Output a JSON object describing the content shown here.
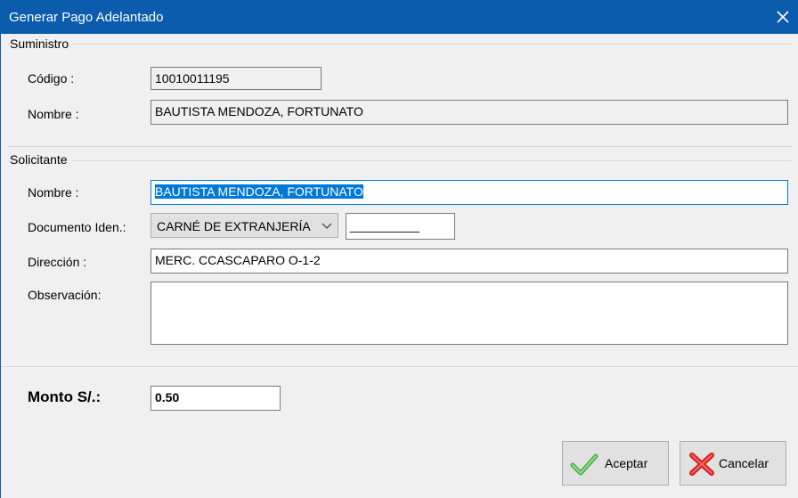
{
  "window": {
    "title": "Generar Pago Adelantado"
  },
  "suministro": {
    "group_title": "Suministro",
    "codigo_label": "Código :",
    "codigo_value": "10010011195",
    "nombre_label": "Nombre :",
    "nombre_value": "BAUTISTA MENDOZA, FORTUNATO"
  },
  "solicitante": {
    "group_title": "Solicitante",
    "nombre_label": "Nombre :",
    "nombre_value": "BAUTISTA MENDOZA, FORTUNATO",
    "documento_label": "Documento Iden.:",
    "documento_type": "CARNÉ DE EXTRANJERÍA",
    "documento_number": "__________",
    "direccion_label": "Dirección :",
    "direccion_value": "MERC. CCASCAPARO O-1-2",
    "observacion_label": "Observación:",
    "observacion_value": ""
  },
  "monto": {
    "label": "Monto S/.:",
    "value": "0.50"
  },
  "buttons": {
    "accept_label": "Aceptar",
    "cancel_label": "Cancelar"
  },
  "colors": {
    "titlebar": "#0b5cad",
    "selection": "#0078d7",
    "accept_icon": "#5cb85c",
    "cancel_icon": "#e02424"
  },
  "icons": {
    "accept": "check-icon",
    "cancel": "x-icon"
  }
}
